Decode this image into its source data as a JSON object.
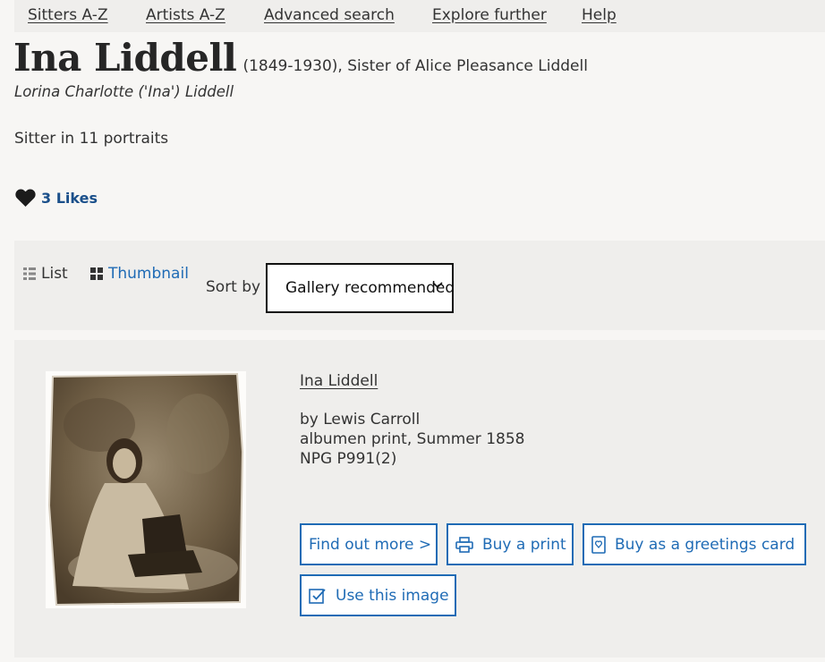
{
  "nav": {
    "items": [
      "Sitters A-Z",
      "Artists A-Z",
      "Advanced search",
      "Explore further",
      "Help"
    ]
  },
  "sitter": {
    "name": "Ina Liddell",
    "dates_desc": "(1849-1930), Sister of Alice Pleasance Liddell",
    "full_name": "Lorina Charlotte ('Ina') Liddell",
    "portrait_count_text": "Sitter in 11 portraits"
  },
  "likes": {
    "label": "3 Likes",
    "icon": "heart-icon"
  },
  "toolbar": {
    "list_label": "List",
    "thumbnail_label": "Thumbnail",
    "sort_label": "Sort by",
    "sort_value": "Gallery recommended",
    "active_view": "Thumbnail"
  },
  "result": {
    "title": "Ina Liddell",
    "artist": "by Lewis Carroll",
    "medium": "albumen print, Summer 1858",
    "ref": "NPG P991(2)",
    "buttons": {
      "find_out_more": "Find out more >",
      "buy_print": "Buy a print",
      "buy_card": "Buy as a greetings card",
      "use_image": "Use this image"
    }
  },
  "colors": {
    "link_blue": "#1f6bb5",
    "likes_blue": "#1a4f8a",
    "background": "#f7f6f4",
    "panel": "#efeeec"
  }
}
